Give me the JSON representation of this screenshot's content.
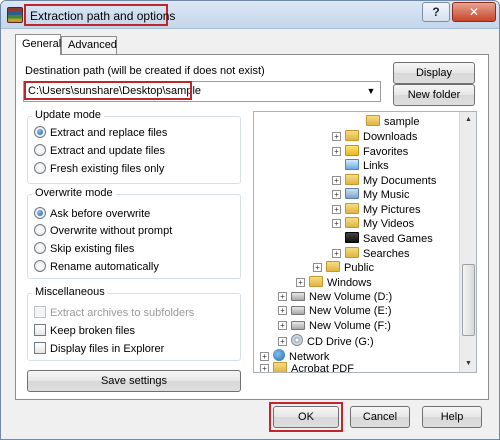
{
  "title": "Extraction path and options",
  "titlebar": {
    "help_label": "?",
    "close_label": "✕"
  },
  "tabs": [
    {
      "label": "General",
      "active": true
    },
    {
      "label": "Advanced",
      "active": false
    }
  ],
  "destination": {
    "label": "Destination path (will be created if does not exist)",
    "value": "C:\\Users\\sunshare\\Desktop\\sample",
    "display_label": "Display",
    "new_folder_label": "New folder"
  },
  "update_mode": {
    "title": "Update mode",
    "options": [
      {
        "label": "Extract and replace files",
        "selected": true
      },
      {
        "label": "Extract and update files",
        "selected": false
      },
      {
        "label": "Fresh existing files only",
        "selected": false
      }
    ]
  },
  "overwrite_mode": {
    "title": "Overwrite mode",
    "options": [
      {
        "label": "Ask before overwrite",
        "selected": true
      },
      {
        "label": "Overwrite without prompt",
        "selected": false
      },
      {
        "label": "Skip existing files",
        "selected": false
      },
      {
        "label": "Rename automatically",
        "selected": false
      }
    ]
  },
  "misc": {
    "title": "Miscellaneous",
    "options": [
      {
        "label": "Extract archives to subfolders",
        "checked": false,
        "disabled": true
      },
      {
        "label": "Keep broken files",
        "checked": false,
        "disabled": false
      },
      {
        "label": "Display files in Explorer",
        "checked": false,
        "disabled": false
      }
    ]
  },
  "save_settings_label": "Save settings",
  "tree": {
    "items": [
      {
        "label": "sample",
        "icon": "folder-icon"
      },
      {
        "label": "Downloads",
        "icon": "folder-icon"
      },
      {
        "label": "Favorites",
        "icon": "star-icon"
      },
      {
        "label": "Links",
        "icon": "link-icon"
      },
      {
        "label": "My Documents",
        "icon": "folder-icon"
      },
      {
        "label": "My Music",
        "icon": "music-icon"
      },
      {
        "label": "My Pictures",
        "icon": "folder-icon"
      },
      {
        "label": "My Videos",
        "icon": "folder-icon"
      },
      {
        "label": "Saved Games",
        "icon": "game-icon"
      },
      {
        "label": "Searches",
        "icon": "search-icon"
      },
      {
        "label": "Public",
        "icon": "folder-icon"
      },
      {
        "label": "Windows",
        "icon": "folder-icon"
      },
      {
        "label": "New Volume (D:)",
        "icon": "drive-icon"
      },
      {
        "label": "New Volume (E:)",
        "icon": "drive-icon"
      },
      {
        "label": "New Volume (F:)",
        "icon": "drive-icon"
      },
      {
        "label": "CD Drive (G:)",
        "icon": "cd-icon"
      },
      {
        "label": "Network",
        "icon": "network-icon"
      },
      {
        "label": "Acrobat PDF",
        "icon": "folder-icon"
      }
    ]
  },
  "buttons": {
    "ok": "OK",
    "cancel": "Cancel",
    "help": "Help"
  },
  "glyphs": {
    "expand": "+",
    "dropdown": "▼",
    "scroll_up": "▲",
    "scroll_down": "▼"
  },
  "colors": {
    "highlight_red": "#c0272d",
    "title_gradient_top": "#dbe7f4"
  }
}
